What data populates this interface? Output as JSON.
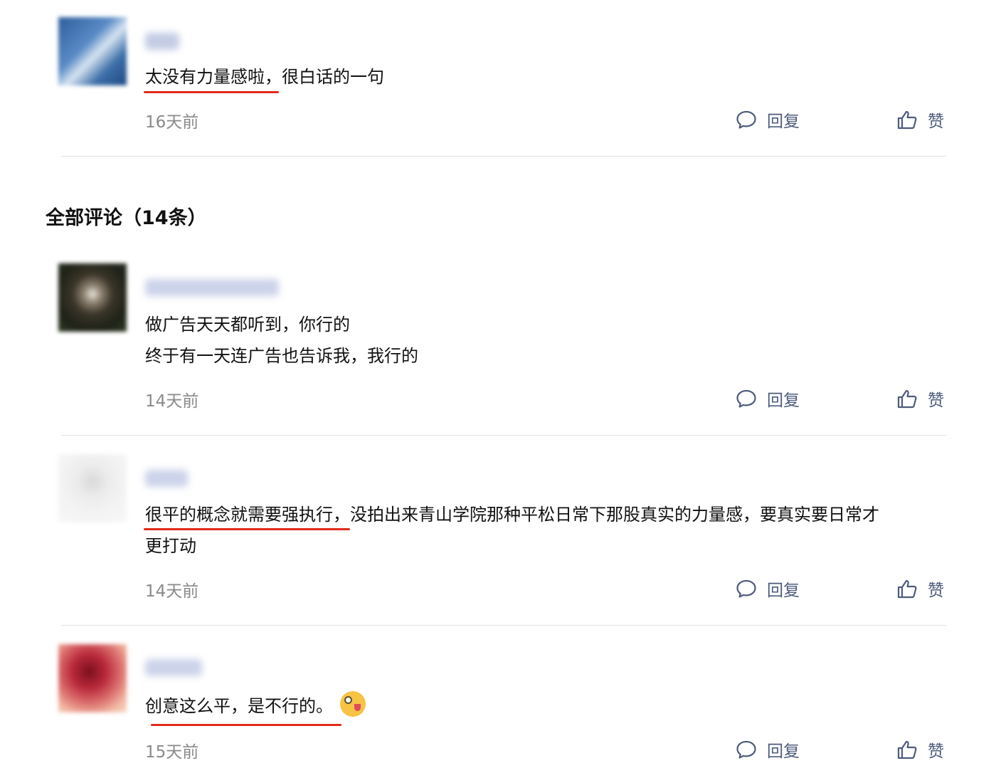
{
  "top_comment": {
    "username": "Ybsj",
    "text": "太没有力量感啦，很白话的一句",
    "time": "16天前",
    "reply_label": "回复",
    "like_label": "赞"
  },
  "section": {
    "title": "全部评论（14条）"
  },
  "comments": [
    {
      "username": "MemoryPuzzle",
      "lines": [
        "做广告天天都听到，你行的",
        "终于有一天连广告也告诉我，我行的"
      ],
      "time": "14天前",
      "reply_label": "回复",
      "like_label": "赞"
    },
    {
      "username": "Jack",
      "lines": [
        "很平的概念就需要强执行，没拍出来青山学院那种平松日常下那股真实的力量感，要真实要日常才",
        "更打动"
      ],
      "time": "14天前",
      "reply_label": "回复",
      "like_label": "赞"
    },
    {
      "username": "二一樱",
      "lines": [
        "创意这么平，是不行的。"
      ],
      "time": "15天前",
      "reply_label": "回复",
      "like_label": "赞"
    }
  ],
  "colors": {
    "accent_underline": "#e02a1b",
    "action_text": "#4e5b7d",
    "time_text": "#8a8a8a",
    "divider": "#e3e3e3"
  },
  "icons": [
    "comment-bubble-icon",
    "thumbs-up-icon",
    "winking-tongue-emoji"
  ]
}
